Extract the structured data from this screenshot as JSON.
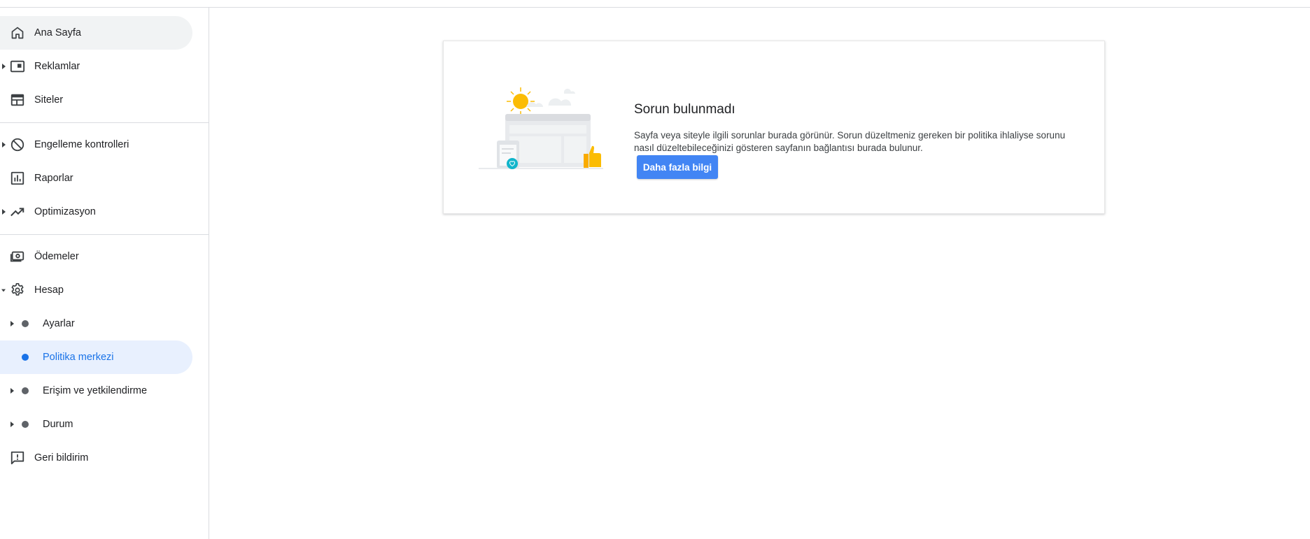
{
  "sidebar": {
    "items": [
      {
        "label": "Ana Sayfa",
        "icon": "home-icon"
      },
      {
        "label": "Reklamlar",
        "icon": "ads-icon"
      },
      {
        "label": "Siteler",
        "icon": "web-icon"
      },
      {
        "label": "Engelleme kontrolleri",
        "icon": "block-icon"
      },
      {
        "label": "Raporlar",
        "icon": "bar-chart-icon"
      },
      {
        "label": "Optimizasyon",
        "icon": "trending-up-icon"
      },
      {
        "label": "Ödemeler",
        "icon": "payments-icon"
      },
      {
        "label": "Hesap",
        "icon": "gear-icon"
      },
      {
        "label": "Ayarlar",
        "icon": "dot-icon"
      },
      {
        "label": "Politika merkezi",
        "icon": "dot-icon"
      },
      {
        "label": "Erişim ve yetkilendirme",
        "icon": "dot-icon"
      },
      {
        "label": "Durum",
        "icon": "dot-icon"
      },
      {
        "label": "Geri bildirim",
        "icon": "feedback-icon"
      }
    ],
    "active_item": "Politika merkezi"
  },
  "main": {
    "card": {
      "title": "Sorun bulunmadı",
      "description": "Sayfa veya siteyle ilgili sorunlar burada görünür. Sorun düzeltmeniz gereken bir politika ihlaliyse sorunu nasıl düzeltebileceğinizi gösteren sayfanın bağlantısı burada bulunur.",
      "button_label": "Daha fazla bilgi"
    }
  },
  "colors": {
    "accent": "#1a73e8",
    "button": "#4285f4",
    "active_bg": "#e8f0fe",
    "home_bg": "#f1f3f4"
  }
}
